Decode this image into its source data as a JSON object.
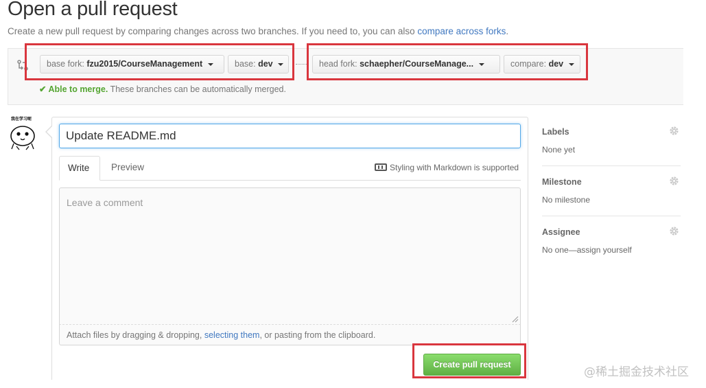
{
  "page": {
    "title": "Open a pull request",
    "subtitle_text": "Create a new pull request by comparing changes across two branches. If you need to, you can also",
    "subtitle_link": "compare across forks",
    "subtitle_end": "."
  },
  "range": {
    "base_fork": {
      "prefix": "base fork:",
      "value": "fzu2015/CourseManagement"
    },
    "base": {
      "prefix": "base:",
      "value": "dev"
    },
    "head_fork": {
      "prefix": "head fork:",
      "value": "schaepher/CourseManage..."
    },
    "compare": {
      "prefix": "compare:",
      "value": "dev"
    },
    "merge_status": "Able to merge.",
    "merge_detail": "These branches can be automatically merged."
  },
  "avatar": {
    "caption": "我在学习呢"
  },
  "form": {
    "title_value": "Update README.md",
    "tabs": [
      {
        "label": "Write"
      },
      {
        "label": "Preview"
      }
    ],
    "markdown_note": "Styling with Markdown is supported",
    "comment_placeholder": "Leave a comment",
    "attach_before": "Attach files by dragging & dropping,",
    "attach_link": "selecting them",
    "attach_after": ", or pasting from the clipboard.",
    "submit_label": "Create pull request"
  },
  "sidebar": {
    "labels": {
      "heading": "Labels",
      "value": "None yet"
    },
    "milestone": {
      "heading": "Milestone",
      "value": "No milestone"
    },
    "assignee": {
      "heading": "Assignee",
      "value": "No one—assign yourself"
    }
  },
  "watermark": "@稀土掘金技术社区",
  "colors": {
    "link": "#4078c0",
    "success": "#55a532",
    "button_green": "#60b044",
    "focus_blue": "#51a7e8",
    "annotation_red": "#d9363e"
  },
  "icons": {
    "compare": "git-compare-icon",
    "caret": "triangle-down-icon",
    "check": "check-icon",
    "markdown": "markdown-icon",
    "gear": "gear-icon"
  }
}
